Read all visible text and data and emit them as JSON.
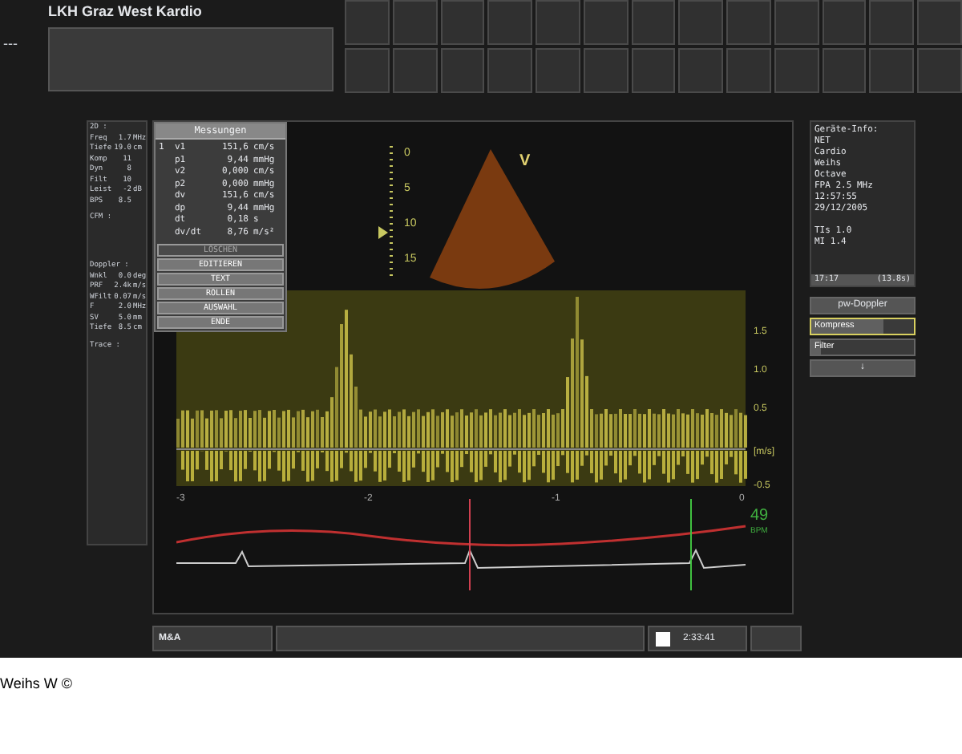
{
  "header": {
    "marker": "---",
    "title": "LKH Graz West Kardio"
  },
  "left_panel": {
    "sections": [
      {
        "heading": "2D :",
        "rows": [
          {
            "label": "Freq",
            "value": "1.7",
            "unit": "MHz"
          },
          {
            "label": "Tiefe",
            "value": "19.0",
            "unit": "cm"
          },
          {
            "label": "Komp",
            "value": "11",
            "unit": ""
          },
          {
            "label": "Dyn",
            "value": "8",
            "unit": ""
          },
          {
            "label": "Filt",
            "value": "10",
            "unit": ""
          },
          {
            "label": "Leist",
            "value": "-2",
            "unit": "dB"
          },
          {
            "label": "BPS",
            "value": "8.5",
            "unit": ""
          }
        ]
      },
      {
        "heading": "CFM :"
      },
      {
        "heading": "Doppler :",
        "rows": [
          {
            "label": "Wnkl",
            "value": "0.0",
            "unit": "deg"
          },
          {
            "label": "PRF",
            "value": "2.4k",
            "unit": "m/s"
          },
          {
            "label": "WFilt",
            "value": "0.07",
            "unit": "m/s"
          },
          {
            "label": "F",
            "value": "2.0",
            "unit": "MHz"
          },
          {
            "label": "SV",
            "value": "5.0",
            "unit": "mm"
          },
          {
            "label": "Tiefe",
            "value": "8.5",
            "unit": "cm"
          }
        ]
      },
      {
        "heading": "Trace :"
      }
    ]
  },
  "measurements": {
    "title": "Messungen",
    "rows": [
      {
        "index": "1",
        "label": "v1",
        "value": "151,6",
        "unit": "cm/s"
      },
      {
        "index": "",
        "label": "p1",
        "value": "9,44",
        "unit": "mmHg"
      },
      {
        "index": "",
        "label": "v2",
        "value": "0,000",
        "unit": "cm/s"
      },
      {
        "index": "",
        "label": "p2",
        "value": "0,000",
        "unit": "mmHg"
      },
      {
        "index": "",
        "label": "dv",
        "value": "151,6",
        "unit": "cm/s"
      },
      {
        "index": "",
        "label": "dp",
        "value": "9,44",
        "unit": "mmHg"
      },
      {
        "index": "",
        "label": "dt",
        "value": "0,18",
        "unit": "s"
      },
      {
        "index": "",
        "label": "dv/dt",
        "value": "8,76",
        "unit": "m/s²"
      }
    ],
    "buttons": [
      {
        "label": "LÖSCHEN",
        "disabled": true
      },
      {
        "label": "EDITIEREN",
        "disabled": false
      },
      {
        "label": "TEXT",
        "disabled": false
      },
      {
        "label": "ROLLEN",
        "disabled": false
      },
      {
        "label": "AUSWAHL",
        "disabled": false
      },
      {
        "label": "ENDE",
        "disabled": false
      }
    ]
  },
  "image": {
    "depth_marks": [
      "0",
      "5",
      "10",
      "15"
    ],
    "view_label": "V"
  },
  "doppler": {
    "velocity_marks": [
      "1.5",
      "1.0",
      "0.5",
      "[m/s]",
      "-0.5"
    ],
    "time_marks": [
      "-3",
      "-2",
      "-1",
      "0"
    ]
  },
  "ecg": {
    "heart_rate": "49",
    "heart_rate_unit": "BPM"
  },
  "device_info": {
    "lines": [
      "Geräte-Info:",
      "NET",
      "Cardio",
      "Weihs",
      "Octave",
      "FPA 2.5 MHz",
      "12:57:55",
      "29/12/2005"
    ],
    "indices": [
      "TIs 1.0",
      "MI 1.4"
    ],
    "frame": "17:17",
    "duration": "(13.8s)"
  },
  "controls": [
    {
      "kind": "button",
      "label": "pw-Doppler",
      "selected": false
    },
    {
      "kind": "slider",
      "label": "Kompress",
      "level": 0.7,
      "selected": true
    },
    {
      "kind": "slider",
      "label": "Filter",
      "level": 0.1,
      "selected": false
    },
    {
      "kind": "button",
      "label": "↓",
      "selected": false
    }
  ],
  "status_bar": {
    "mode": "M&A",
    "checked": false,
    "time": "2:33:41"
  },
  "credit": "Weihs W ©"
}
